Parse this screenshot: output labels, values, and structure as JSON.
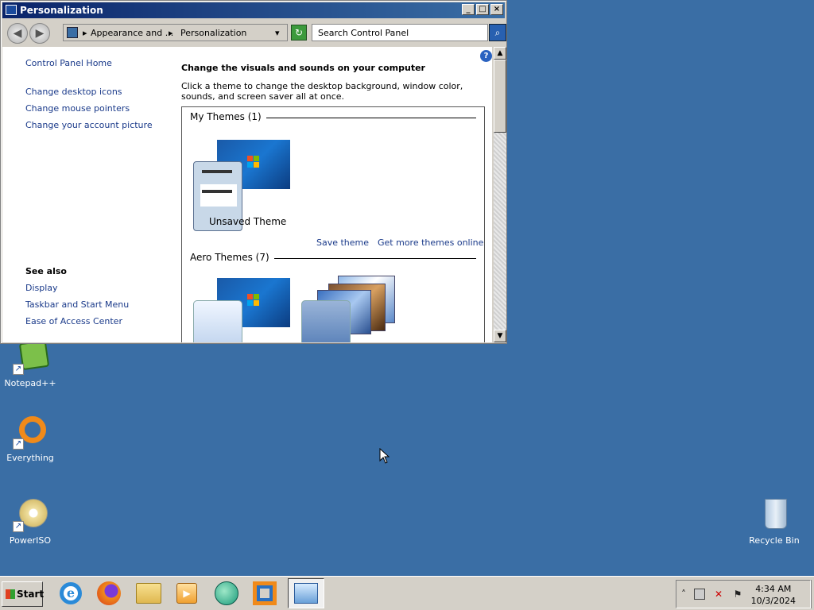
{
  "window": {
    "title": "Personalization",
    "btn_min": "_",
    "btn_max": "□",
    "btn_close": "×"
  },
  "navbar": {
    "back_glyph": "◀",
    "forward_glyph": "▶",
    "breadcrumb_1": "Appearance and ...",
    "breadcrumb_2": "Personalization",
    "search_placeholder": "Search Control Panel",
    "arrow": "▸",
    "dropdown": "▾",
    "refresh": "↻",
    "search_icon": "⌕"
  },
  "sidebar": {
    "home": "Control Panel Home",
    "links": [
      "Change desktop icons",
      "Change mouse pointers",
      "Change your account picture"
    ],
    "see_also_title": "See also",
    "see_also": [
      "Display",
      "Taskbar and Start Menu",
      "Ease of Access Center"
    ]
  },
  "main": {
    "heading": "Change the visuals and sounds on your computer",
    "description": "Click a theme to change the desktop background, window color, sounds, and screen saver all at once.",
    "my_themes_title": "My Themes (1)",
    "unsaved_theme": "Unsaved Theme",
    "save_theme": "Save theme",
    "get_more": "Get more themes online",
    "aero_title": "Aero Themes (7)",
    "help": "?"
  },
  "scrollbar": {
    "up": "▲",
    "down": "▼"
  },
  "desktop": {
    "icons": [
      "Notepad++",
      "Everything",
      "PowerISO",
      "Recycle Bin"
    ],
    "shortcut_arrow": "↗"
  },
  "taskbar": {
    "start": "Start",
    "clock_time": "4:34 AM",
    "clock_date": "10/3/2024",
    "tray_expand": "˄"
  },
  "colors": {
    "desktop": "#3a6ea5",
    "link": "#1a3a8a",
    "titlebar": "#0a246a"
  },
  "icons": [
    "window-icon",
    "back-icon",
    "forward-icon",
    "control-panel-icon",
    "refresh-icon",
    "search-icon",
    "help-icon",
    "ie-icon",
    "firefox-icon",
    "explorer-icon",
    "media-player-icon",
    "app-icon",
    "virtualbox-icon",
    "control-panel-task-icon",
    "network-icon",
    "volume-muted-icon",
    "flag-icon"
  ]
}
